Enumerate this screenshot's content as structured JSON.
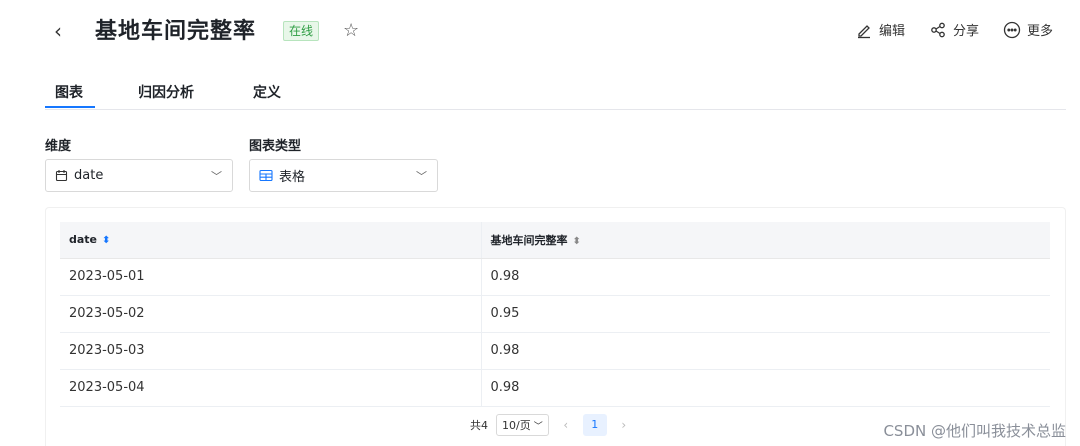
{
  "header": {
    "title": "基地车间完整率",
    "badge": "在线",
    "actions": [
      {
        "label": "编辑",
        "icon": "edit-icon"
      },
      {
        "label": "分享",
        "icon": "share-icon"
      },
      {
        "label": "更多",
        "icon": "more-icon"
      }
    ]
  },
  "tabs": [
    {
      "label": "图表",
      "active": true
    },
    {
      "label": "归因分析",
      "active": false
    },
    {
      "label": "定义",
      "active": false
    }
  ],
  "controls": {
    "dimension": {
      "label": "维度",
      "value": "date",
      "icon": "calendar-icon"
    },
    "chart_type": {
      "label": "图表类型",
      "value": "表格",
      "icon": "table-icon"
    }
  },
  "table": {
    "columns": [
      "date",
      "基地车间完整率"
    ],
    "rows": [
      [
        "2023-05-01",
        "0.98"
      ],
      [
        "2023-05-02",
        "0.95"
      ],
      [
        "2023-05-03",
        "0.98"
      ],
      [
        "2023-05-04",
        "0.98"
      ]
    ]
  },
  "pagination": {
    "total": "共4",
    "page_size": "10/页",
    "current": "1"
  },
  "watermark": "CSDN @他们叫我技术总监",
  "colors": {
    "accent": "#1677ff",
    "badge_green": "#2f9e44"
  }
}
